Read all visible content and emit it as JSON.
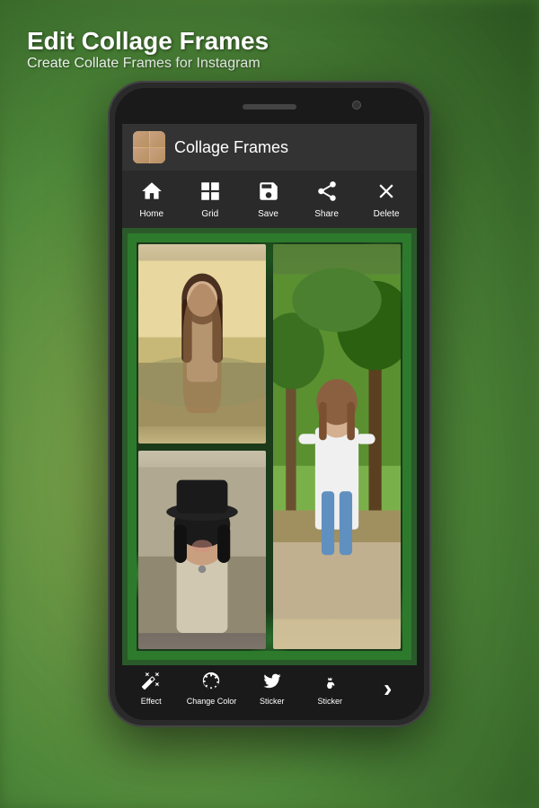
{
  "app": {
    "title_h1": "Edit Collage Frames",
    "subtitle": "Create Collate Frames for Instagram",
    "app_name": "Collage Frames"
  },
  "toolbar": {
    "items": [
      {
        "id": "home",
        "label": "Home",
        "icon": "home"
      },
      {
        "id": "grid",
        "label": "Grid",
        "icon": "grid"
      },
      {
        "id": "save",
        "label": "Save",
        "icon": "save"
      },
      {
        "id": "share",
        "label": "Share",
        "icon": "share"
      },
      {
        "id": "delete",
        "label": "Delete",
        "icon": "delete"
      }
    ]
  },
  "bottom_toolbar": {
    "items": [
      {
        "id": "effect",
        "label": "Effect",
        "icon": "sparkle"
      },
      {
        "id": "change_color",
        "label": "Change Color",
        "icon": "aperture"
      },
      {
        "id": "sticker1",
        "label": "Sticker",
        "icon": "bird"
      },
      {
        "id": "sticker2",
        "label": "Sticker",
        "icon": "flower"
      },
      {
        "id": "next",
        "label": "›",
        "icon": "chevron-right"
      }
    ]
  },
  "colors": {
    "bg_gradient_start": "#8fbc5a",
    "bg_gradient_end": "#3a6a2a",
    "toolbar_bg": "#2a2a2a",
    "header_bg": "#333333",
    "collage_border": "#2d7a2d",
    "bottom_bg": "#1a1a1a"
  }
}
